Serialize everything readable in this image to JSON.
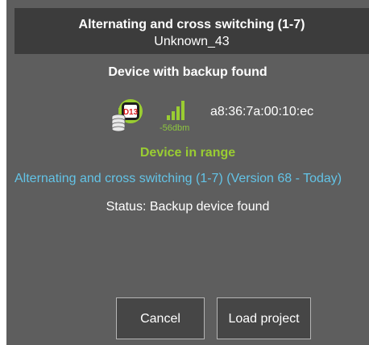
{
  "dialog": {
    "title": "Alternating and cross switching (1-7)",
    "subtitle": "Unknown_43",
    "heading": "Device with backup found"
  },
  "device": {
    "icon": "device-with-backup-icon",
    "badge_label": "D13",
    "signal_icon": "signal-strength-icon",
    "signal_strength": "-56dbm",
    "mac_address": "a8:36:7a:00:10:ec",
    "range_status": "Device in range",
    "project_line": "Alternating and cross switching (1-7) (Version 68 - Today)",
    "status": "Status: Backup device found"
  },
  "buttons": {
    "cancel": "Cancel",
    "load_project": "Load project"
  },
  "colors": {
    "dialog_bg": "#5e5e5e",
    "header_bg": "#3c3c3c",
    "accent_green": "#9acd32",
    "accent_blue": "#63c3e6",
    "button_bg": "#464646"
  }
}
